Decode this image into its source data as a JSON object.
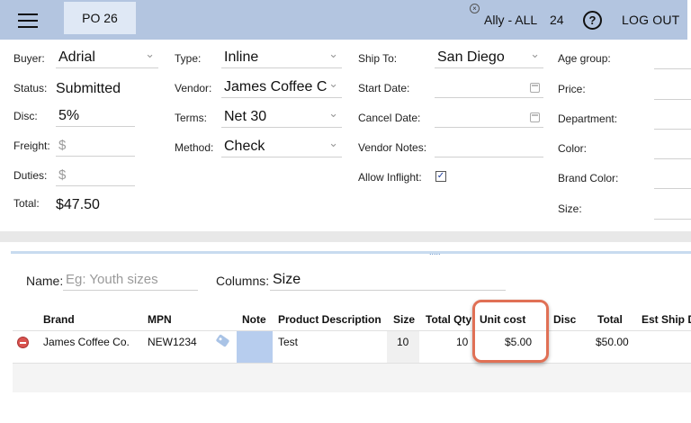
{
  "header": {
    "po_title": "PO 26",
    "user": "Ally - ALL",
    "count": "24",
    "help": "?",
    "logout": "LOG OUT",
    "clear": "×"
  },
  "form": {
    "buyer_label": "Buyer:",
    "buyer": "Adrial",
    "status_label": "Status:",
    "status": "Submitted",
    "disc_label": "Disc:",
    "disc": "5%",
    "freight_label": "Freight:",
    "freight_placeholder": "$",
    "duties_label": "Duties:",
    "duties_placeholder": "$",
    "total_label": "Total:",
    "total": "$47.50",
    "type_label": "Type:",
    "type": "Inline",
    "vendor_label": "Vendor:",
    "vendor": "James Coffee C",
    "terms_label": "Terms:",
    "terms": "Net 30",
    "method_label": "Method:",
    "method": "Check",
    "ship_to_label": "Ship To:",
    "ship_to": "San Diego",
    "start_date_label": "Start Date:",
    "cancel_date_label": "Cancel Date:",
    "vendor_notes_label": "Vendor Notes:",
    "allow_inflight_label": "Allow Inflight:",
    "allow_inflight_check": "✓",
    "age_group_label": "Age group:",
    "price_label": "Price:",
    "department_label": "Department:",
    "color_label": "Color:",
    "brand_color_label": "Brand Color:",
    "size_label": "Size:"
  },
  "divider": {
    "grip": "....."
  },
  "line_items": {
    "name_label": "Name:",
    "name_placeholder": "Eg: Youth sizes",
    "columns_label": "Columns:",
    "columns_value": "Size",
    "headers": {
      "brand": "Brand",
      "mpn": "MPN",
      "note": "Note",
      "product_description": "Product Description",
      "size": "Size",
      "total_qty": "Total Qty",
      "unit_cost": "Unit cost",
      "disc": "Disc",
      "total": "Total",
      "est_ship": "Est Ship D"
    },
    "rows": [
      {
        "brand": "James Coffee Co.",
        "mpn": "NEW1234",
        "product_description": "Test",
        "size": "10",
        "total_qty": "10",
        "unit_cost": "$5.00",
        "disc": "",
        "total": "$50.00"
      }
    ]
  },
  "colors": {
    "header_bg": "#b3c5e0",
    "highlight": "#e07055",
    "note_cell": "#b7cdee"
  }
}
